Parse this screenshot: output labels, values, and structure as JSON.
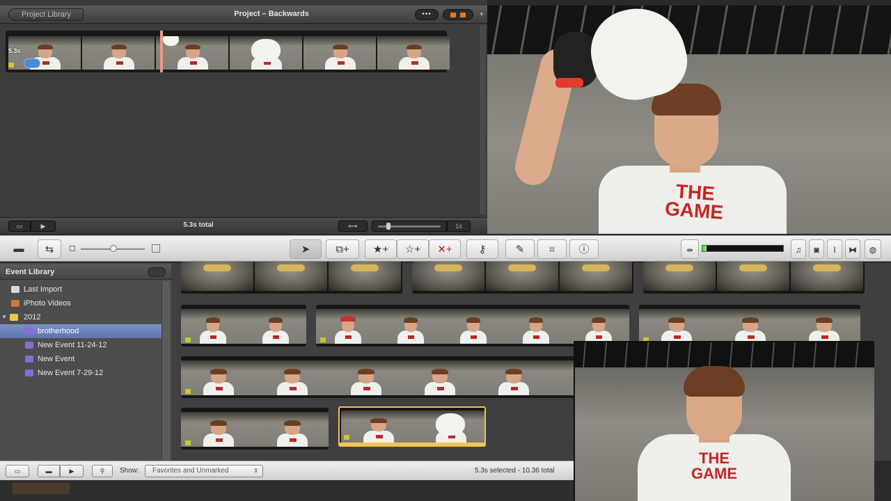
{
  "project": {
    "library_button": "Project Library",
    "title": "Project – Backwards",
    "options_button": "•••",
    "clip_duration": "5.3s",
    "total": "5.3s total",
    "zoom_value": "1s"
  },
  "toolbar": {
    "tools": [
      "select",
      "add-to-project",
      "mark-favorite",
      "unmark",
      "reject",
      "keyword",
      "eyedropper",
      "crop",
      "inspector"
    ],
    "audio_meter_level": 0.05
  },
  "event_library": {
    "title": "Event Library",
    "items": [
      {
        "label": "Last Import"
      },
      {
        "label": "iPhoto Videos"
      },
      {
        "label": "2012"
      },
      {
        "label": "brotherhood"
      },
      {
        "label": "New Event 11-24-12"
      },
      {
        "label": "New Event"
      },
      {
        "label": "New Event 7-29-12"
      }
    ],
    "selected": "brotherhood"
  },
  "viewer": {
    "shirt_text": "THE GAME"
  },
  "pip": {
    "shirt_text": "THE GAME"
  },
  "bottom_bar": {
    "show_label": "Show:",
    "show_value": "Favorites and Unmarked",
    "status": "5.3s selected - 10.36 total"
  },
  "colors": {
    "accent_selection": "#f2c455",
    "library_selection": "#6d84bd",
    "playhead": "#e89a84",
    "audio_meter": "#47d442"
  },
  "icons": {
    "swap": "swap-icon",
    "camera": "camera-icon",
    "select": "arrow-cursor-icon",
    "favorite": "star-plus-icon",
    "unmark": "outline-star-plus-icon",
    "reject": "x-plus-icon",
    "keyword": "key-icon",
    "eyedropper": "eyedropper-icon",
    "crop": "crop-icon",
    "inspector": "info-icon"
  }
}
